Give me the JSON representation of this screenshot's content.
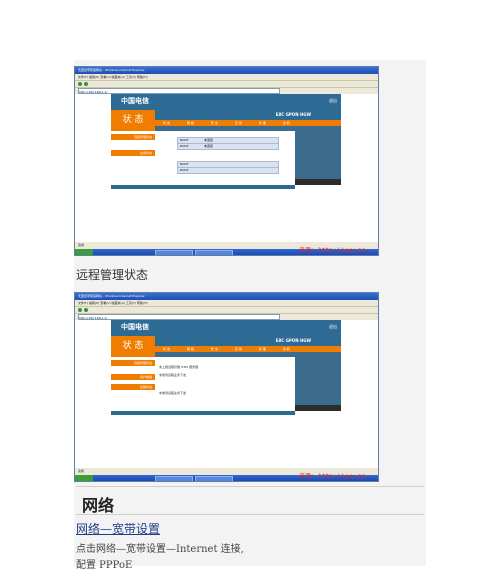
{
  "document": {
    "caption_remote": "远程管理状态",
    "section_heading": "网络",
    "link_text": "网络—宽带设置",
    "description": "点击网络—宽带设置—Internet 连接,",
    "config_line": "配置 PPPoE"
  },
  "screenshots": [
    {
      "window_title": "天翼宽带家庭网关 - Windows Internet Explorer",
      "menu": "文件(F)  编辑(E)  查看(V)  收藏夹(A)  工具(T)  帮助(H)",
      "address": "http://192.168.1.1/",
      "brand": "中国电信",
      "model": "E8C GPON HGW",
      "logout": "退出",
      "panel_title": "状 态",
      "tabs": [
        "状 态",
        "网 络",
        "安 全",
        "应 用",
        "管 理",
        "诊 断"
      ],
      "left_items": [
        "远程管理状态",
        "业务状态"
      ],
      "rows": [
        {
          "key": "ROOT",
          "value": "未连接"
        },
        {
          "key": "ROOT",
          "value": "未连接"
        },
        {
          "key": "ROOT",
          "value": ""
        },
        {
          "key": "ROOT",
          "value": ""
        }
      ],
      "status_text": "完成",
      "watermark": "来源: http://www.pc..."
    },
    {
      "window_title": "天翼宽带家庭网关 - Windows Internet Explorer",
      "menu": "文件(F)  编辑(E)  查看(V)  收藏夹(A)  工具(T)  帮助(H)",
      "address": "http://192.168.1.1/",
      "brand": "中国电信",
      "model": "E8C GPON HGW",
      "logout": "退出",
      "panel_title": "状 态",
      "tabs": [
        "状 态",
        "网 络",
        "安 全",
        "应 用",
        "管 理",
        "诊 断"
      ],
      "left_items": [
        "远程管理状态",
        "用户数据",
        "链路状态"
      ],
      "lines": [
        "未上报远程管理 ITMS 服务器",
        "未收到远程业务下发",
        "未收到远程业务下发"
      ],
      "status_text": "完成",
      "watermark": "来源: http://www.pc..."
    }
  ]
}
